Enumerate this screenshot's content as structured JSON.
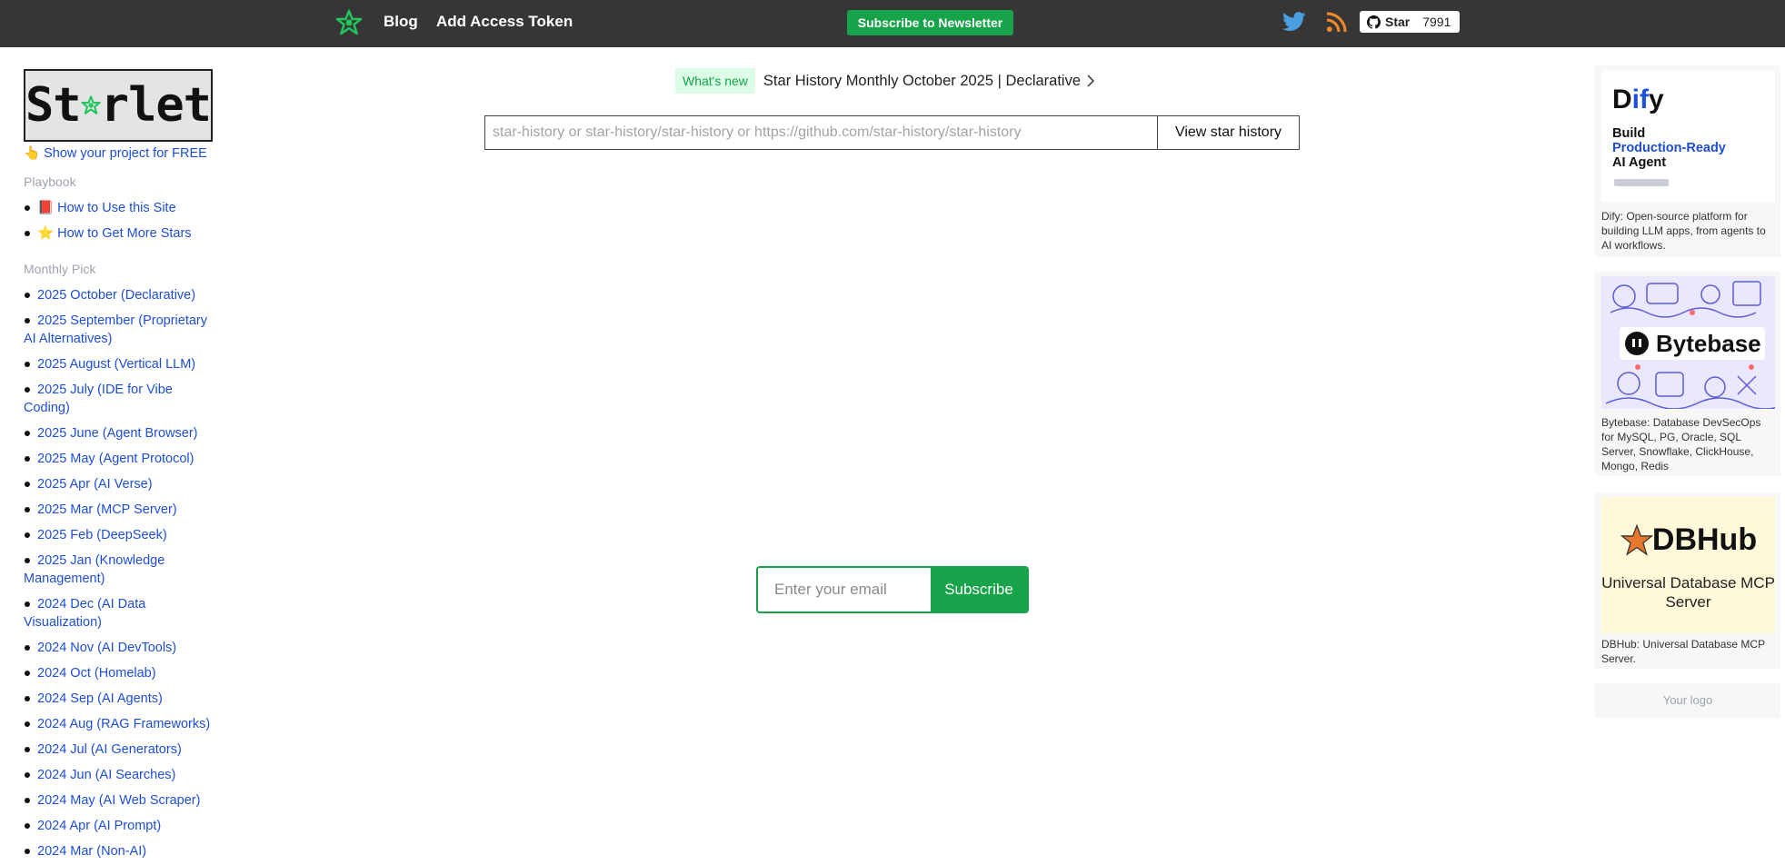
{
  "nav": {
    "blog": "Blog",
    "add_token": "Add Access Token",
    "subscribe": "Subscribe to Newsletter",
    "github_star_label": "Star",
    "github_star_count": "7991"
  },
  "sidebar": {
    "logo_text_left": "St",
    "logo_text_right": "rlet",
    "show_project": "Show your project for FREE",
    "playbook_title": "Playbook",
    "playbook": [
      "How to Use this Site",
      "How to Get More Stars"
    ],
    "monthly_title": "Monthly Pick",
    "monthly": [
      "2025 October (Declarative)",
      "2025 September (Proprietary AI Alternatives)",
      "2025 August (Vertical LLM)",
      "2025 July (IDE for Vibe Coding)",
      "2025 June (Agent Browser)",
      "2025 May (Agent Protocol)",
      "2025 Apr (AI Verse)",
      "2025 Mar (MCP Server)",
      "2025 Feb (DeepSeek)",
      "2025 Jan (Knowledge Management)",
      "2024 Dec (AI Data Visualization)",
      "2024 Nov (AI DevTools)",
      "2024 Oct (Homelab)",
      "2024 Sep (AI Agents)",
      "2024 Aug (RAG Frameworks)",
      "2024 Jul (AI Generators)",
      "2024 Jun (AI Searches)",
      "2024 May (AI Web Scraper)",
      "2024 Apr (AI Prompt)",
      "2024 Mar (Non-AI)"
    ]
  },
  "main": {
    "whats_new_badge": "What's new",
    "whats_new_text": "Star History Monthly October 2025 | Declarative",
    "search_placeholder": "star-history or star-history/star-history or https://github.com/star-history/star-history",
    "search_button": "View star history",
    "email_placeholder": "Enter your email",
    "email_button": "Subscribe"
  },
  "ads": {
    "dify": {
      "brand_a": "D",
      "brand_b": "if",
      "brand_c": "y",
      "line1": "Build",
      "line2": "Production-Ready",
      "line3": "AI Agent",
      "caption": "Dify: Open-source platform for building LLM apps, from agents to AI workflows."
    },
    "bytebase": {
      "brand": "Bytebase",
      "caption": "Bytebase: Database DevSecOps for MySQL, PG, Oracle, SQL Server, Snowflake, ClickHouse, Mongo, Redis"
    },
    "dbhub": {
      "brand": "DBHub",
      "sub": "Universal Database MCP Server",
      "caption": "DBHub: Universal Database MCP Server."
    },
    "your_logo": "Your logo"
  },
  "colors": {
    "topbar": "#363636",
    "accent_green": "#16a34a",
    "link_blue": "#1d4ed8"
  }
}
